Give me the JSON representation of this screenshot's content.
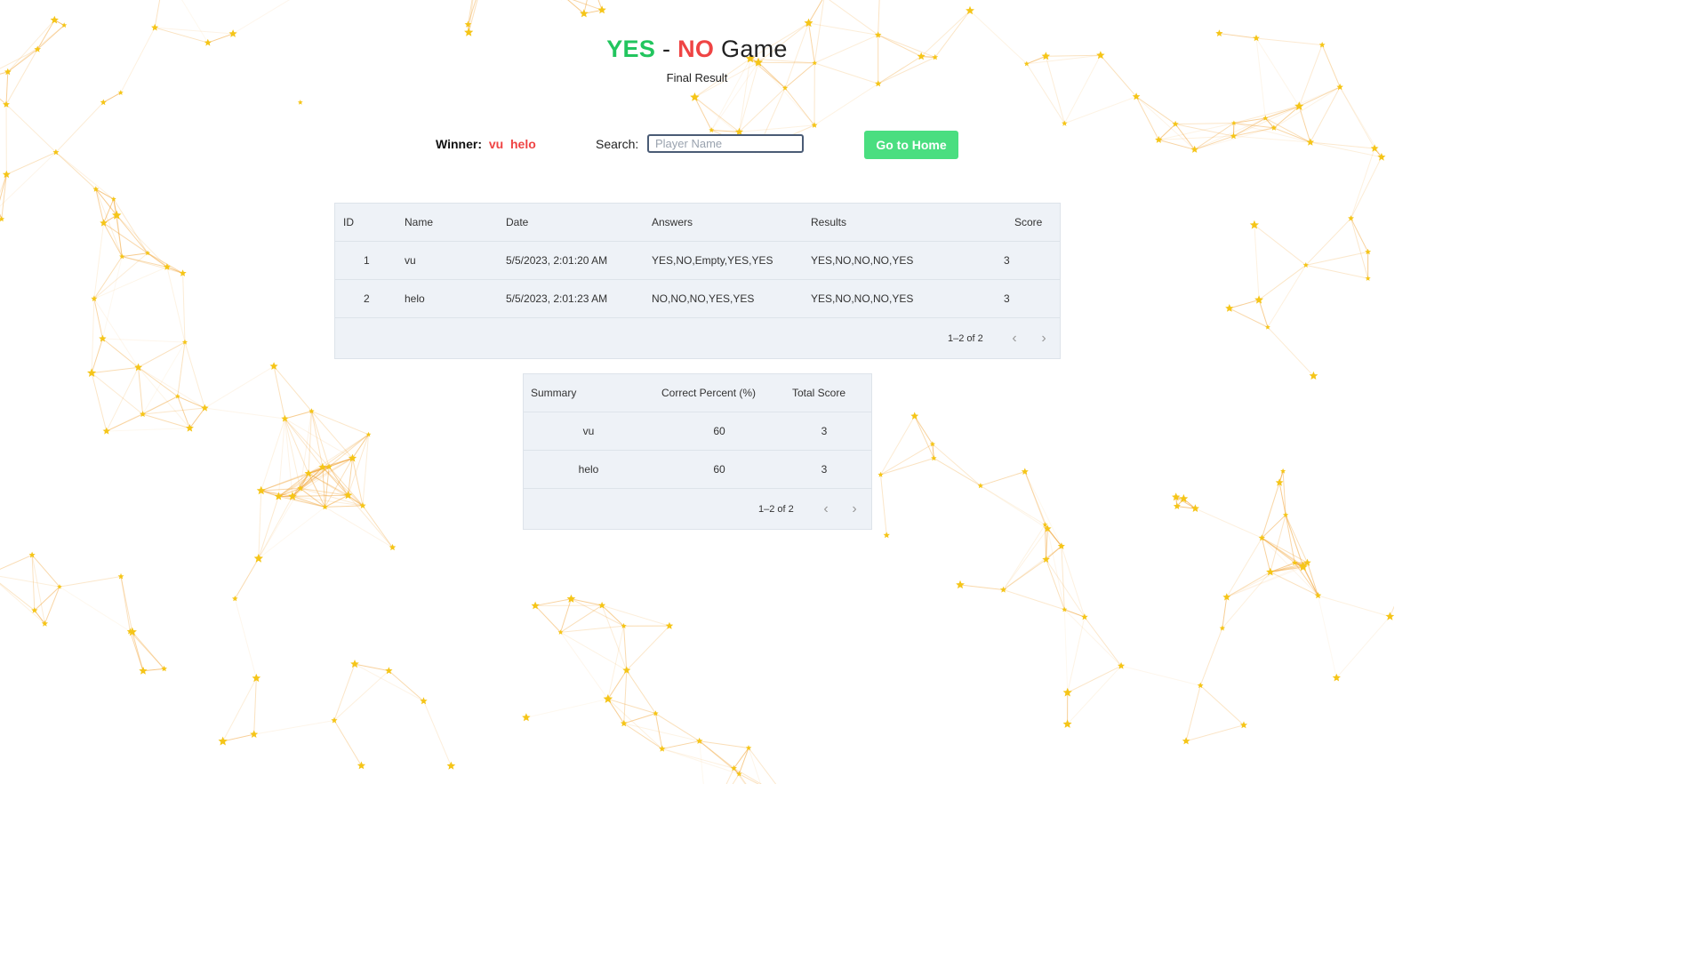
{
  "header": {
    "title_yes": "YES",
    "title_sep": "-",
    "title_no": "NO",
    "title_game": "Game",
    "subtitle": "Final Result"
  },
  "toolbar": {
    "winner_label": "Winner:",
    "winner_names": "vu  helo",
    "search_label": "Search:",
    "search_placeholder": "Player Name",
    "search_value": "",
    "home_button": "Go to Home"
  },
  "results_table": {
    "columns": [
      "ID",
      "Name",
      "Date",
      "Answers",
      "Results",
      "Score"
    ],
    "rows": [
      [
        "1",
        "vu",
        "5/5/2023, 2:01:20 AM",
        "YES,NO,Empty,YES,YES",
        "YES,NO,NO,NO,YES",
        "3"
      ],
      [
        "2",
        "helo",
        "5/5/2023, 2:01:23 AM",
        "NO,NO,NO,YES,YES",
        "YES,NO,NO,NO,YES",
        "3"
      ]
    ],
    "pagination": "1–2 of 2"
  },
  "summary_table": {
    "columns": [
      "Summary",
      "Correct Percent (%)",
      "Total Score"
    ],
    "rows": [
      [
        "vu",
        "60",
        "3"
      ],
      [
        "helo",
        "60",
        "3"
      ]
    ],
    "pagination": "1–2 of 2"
  },
  "colors": {
    "yes": "#22c55e",
    "no": "#ef4444",
    "button": "#4ade80",
    "network_line": "#f0a030",
    "star": "#f5c518"
  },
  "icons": {
    "prev": "chevron-left-icon",
    "next": "chevron-right-icon",
    "background": "star-network-pattern"
  }
}
